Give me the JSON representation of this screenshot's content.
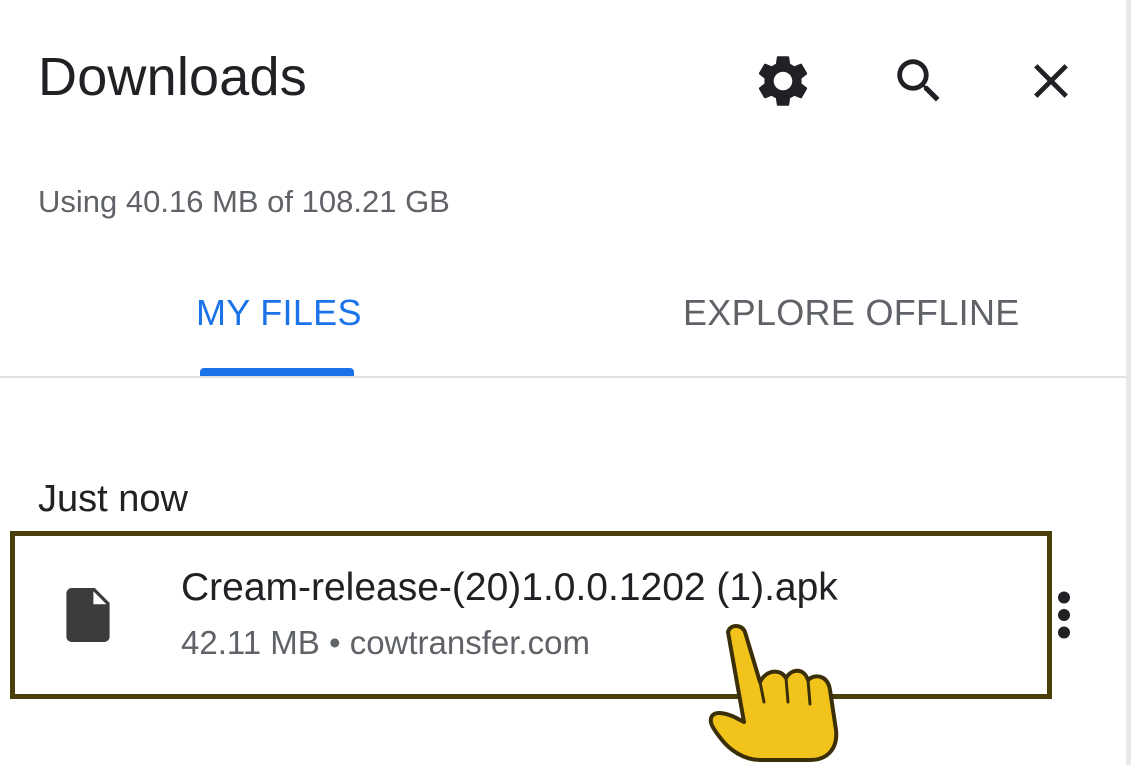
{
  "header": {
    "title": "Downloads",
    "icons": [
      "gear-icon",
      "search-icon",
      "close-icon"
    ]
  },
  "storage": {
    "usage_text": "Using 40.16 MB of 108.21 GB"
  },
  "tabs": [
    {
      "label": "MY FILES",
      "selected": true
    },
    {
      "label": "EXPLORE OFFLINE",
      "selected": false
    }
  ],
  "downloads": {
    "section_label": "Just now",
    "items": [
      {
        "name": "Cream-release-(20)1.0.0.1202 (1).apk",
        "meta": "42.11 MB • cowtransfer.com",
        "icon": "file-icon"
      }
    ]
  },
  "colors": {
    "accent": "#1a73e8",
    "text_primary": "#202124",
    "text_secondary": "#5f6368",
    "highlight_border": "#4a3f0a",
    "pointer_fill": "#f2c31b"
  }
}
